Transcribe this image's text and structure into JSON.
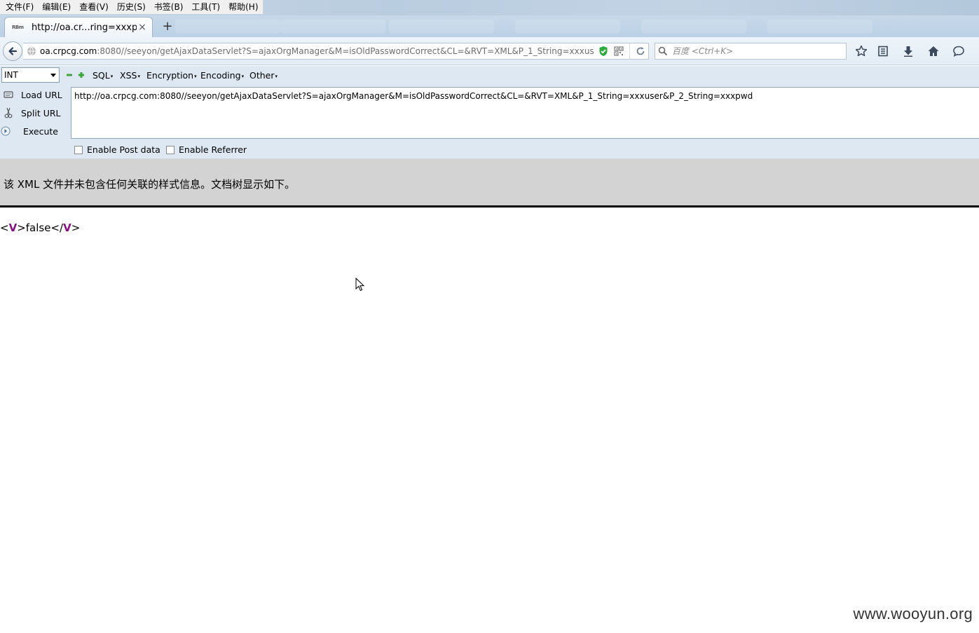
{
  "menubar": {
    "items": [
      "文件(F)",
      "编辑(E)",
      "查看(V)",
      "历史(S)",
      "书签(B)",
      "工具(T)",
      "帮助(H)"
    ]
  },
  "tabs": {
    "active": {
      "favicon_text": "RBm",
      "title": "http://oa.cr...ring=xxxpwd",
      "close_glyph": "×"
    },
    "new_tab_glyph": "+"
  },
  "navbar": {
    "url_host": "oa.crpcg.com",
    "url_rest": ":8080//seeyon/getAjaxDataServlet?S=ajaxOrgManager&M=isOldPasswordCorrect&CL=&RVT=XML&P_1_String=xxxus",
    "search_placeholder": "百度 <Ctrl+K>",
    "icons": [
      "back-arrow-icon",
      "globe-icon",
      "shield-check-icon",
      "qr-code-icon",
      "reload-icon",
      "search-icon",
      "bookmark-star-icon",
      "reading-list-icon",
      "download-icon",
      "home-icon",
      "chat-icon"
    ]
  },
  "hackbar": {
    "level": "INT",
    "menus": [
      "SQL",
      "XSS",
      "Encryption",
      "Encoding",
      "Other"
    ],
    "actions": {
      "load_url": "Load URL",
      "split_url": "Split URL",
      "execute": "Execute"
    },
    "url_value": "http://oa.crpcg.com:8080//seeyon/getAjaxDataServlet?S=ajaxOrgManager&M=isOldPasswordCorrect&CL=&RVT=XML&P_1_String=xxxuser&P_2_String=xxxpwd",
    "enable_post": "Enable Post data",
    "enable_referrer": "Enable Referrer"
  },
  "xml_view": {
    "banner": "该 XML 文件并未包含任何关联的样式信息。文档树显示如下。",
    "open_lt": "<",
    "tag": "V",
    "open_gt": ">",
    "value": "false",
    "close_lt": "</",
    "close_gt": ">"
  },
  "watermark": "www.wooyun.org"
}
